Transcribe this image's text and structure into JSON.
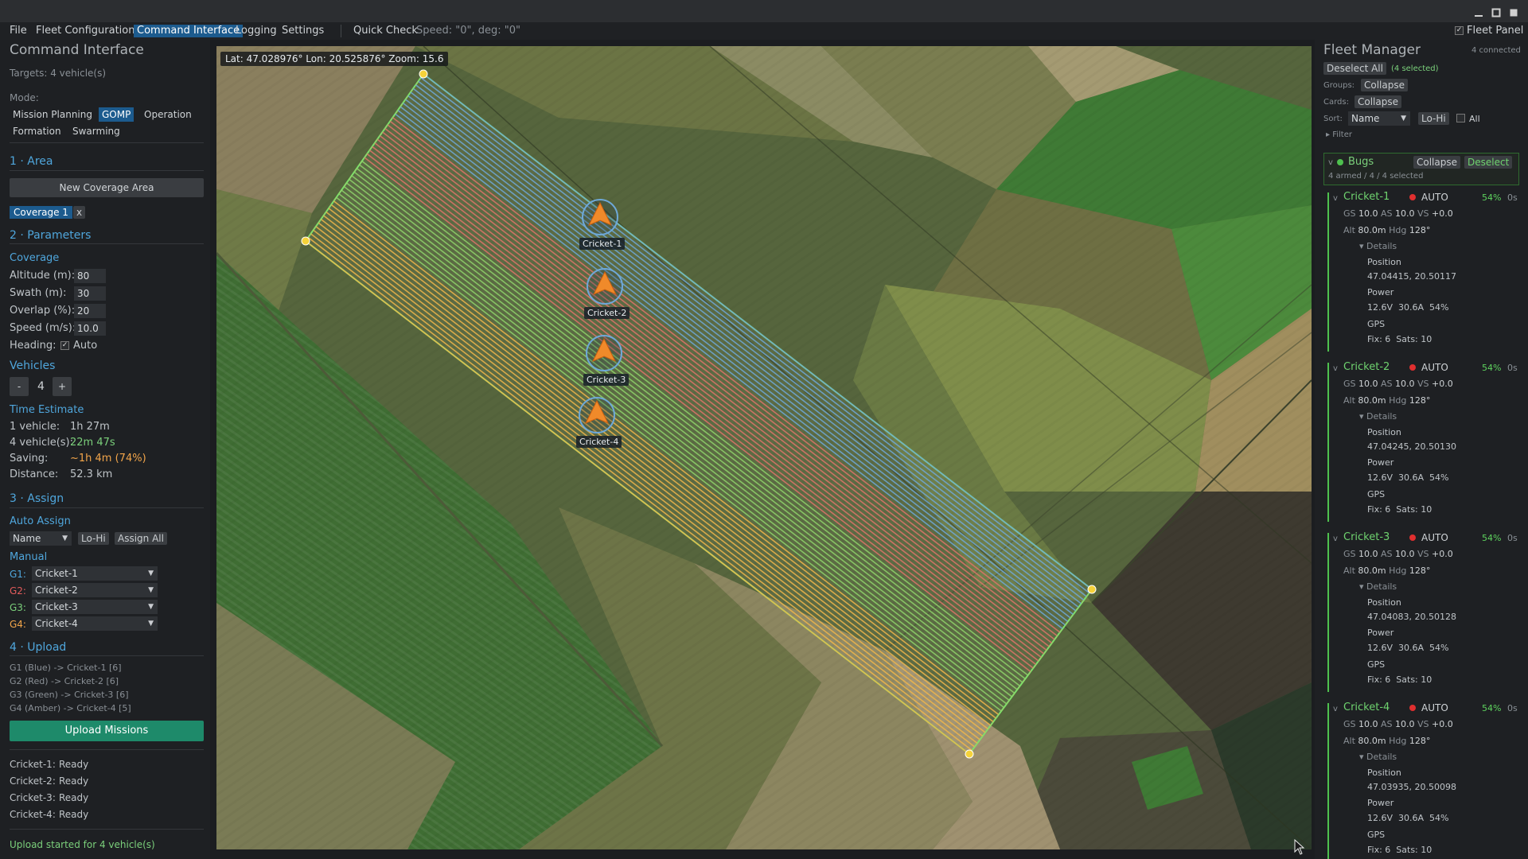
{
  "menu": {
    "items": [
      "File",
      "Fleet Configuration",
      "Command Interface",
      "Logging",
      "Settings"
    ],
    "quick_check": "Quick Check",
    "speed_readout": "Speed: \"0\", deg: \"0\"",
    "fleet_panel_label": "Fleet Panel"
  },
  "left": {
    "title": "Command Interface",
    "targets": "Targets: 4 vehicle(s)",
    "mode_label": "Mode:",
    "modes": [
      "Mission Planning",
      "GOMP",
      "Operation",
      "Formation",
      "Swarming"
    ],
    "area_header": "1 · Area",
    "new_area_button": "New Coverage Area",
    "coverage_chip": "Coverage 1",
    "coverage_close": "x",
    "params_header": "2 · Parameters",
    "coverage_sub": "Coverage",
    "altitude_label": "Altitude (m):",
    "altitude_value": "80",
    "swath_label": "Swath (m):",
    "swath_value": "30",
    "overlap_label": "Overlap (%):",
    "overlap_value": "20",
    "speed_label": "Speed (m/s):",
    "speed_value": "10.0",
    "heading_label": "Heading:",
    "heading_auto": "Auto",
    "vehicles_sub": "Vehicles",
    "minus": "-",
    "vehicle_count": "4",
    "plus": "+",
    "time_sub": "Time Estimate",
    "one_vehicle_label": "1 vehicle:",
    "one_vehicle_value": "1h 27m",
    "n_vehicle_label": "4 vehicle(s):",
    "n_vehicle_value": "22m 47s",
    "saving_label": "Saving:",
    "saving_value": "~1h 4m (74%)",
    "distance_label": "Distance:",
    "distance_value": "52.3 km",
    "assign_header": "3 · Assign",
    "auto_assign_sub": "Auto Assign",
    "sort_value": "Name",
    "lohi": "Lo-Hi",
    "assign_all": "Assign All",
    "manual_sub": "Manual",
    "groups": [
      {
        "label": "G1:",
        "value": "Cricket-1",
        "color": "#4fa6dc"
      },
      {
        "label": "G2:",
        "value": "Cricket-2",
        "color": "#e25b5b"
      },
      {
        "label": "G3:",
        "value": "Cricket-3",
        "color": "#7bd07b"
      },
      {
        "label": "G4:",
        "value": "Cricket-4",
        "color": "#f2a54a"
      }
    ],
    "upload_header": "4 · Upload",
    "upload_lines": [
      "G1 (Blue) -> Cricket-1 [6]",
      "G2 (Red) -> Cricket-2 [6]",
      "G3 (Green) -> Cricket-3 [6]",
      "G4 (Amber) -> Cricket-4 [5]"
    ],
    "upload_button": "Upload Missions",
    "status": [
      {
        "name": "Cricket-1:",
        "state": "Ready"
      },
      {
        "name": "Cricket-2:",
        "state": "Ready"
      },
      {
        "name": "Cricket-3:",
        "state": "Ready"
      },
      {
        "name": "Cricket-4:",
        "state": "Ready"
      }
    ],
    "footer": "Upload started for 4 vehicle(s)"
  },
  "map": {
    "coords": "Lat: 47.028976° Lon: 20.525876° Zoom: 15.6",
    "vehicles": [
      "Cricket-1",
      "Cricket-2",
      "Cricket-3",
      "Cricket-4"
    ],
    "group_colors": {
      "blue": "#6ea8d8",
      "red": "#e0736a",
      "green": "#8fd46a",
      "amber": "#f0b64a"
    }
  },
  "right": {
    "title": "Fleet Manager",
    "connected": "4 connected",
    "deselect_all": "Deselect All",
    "selected": "(4 selected)",
    "groups_label": "Groups:",
    "groups_btn": "Collapse",
    "cards_label": "Cards:",
    "cards_btn": "Collapse",
    "sort_label": "Sort:",
    "sort_value": "Name",
    "lohi": "Lo-Hi",
    "all": "All",
    "filter": "Filter",
    "group_name": "Bugs",
    "group_collapse": "Collapse",
    "group_deselect": "Deselect",
    "group_summary": "4 armed / 4 / 4 selected",
    "vehicles": [
      {
        "name": "Cricket-1",
        "mode": "AUTO",
        "pct": "54%",
        "age": "0s",
        "gs": "10.0",
        "as": "10.0",
        "vs": "+0.0",
        "alt": "80.0m",
        "hdg": "128°",
        "details": "Details",
        "position_label": "Position",
        "position": "47.04415, 20.50117",
        "power_label": "Power",
        "power": "12.6V  30.6A  54%",
        "gps_label": "GPS",
        "gps": "Fix: 6  Sats: 10"
      },
      {
        "name": "Cricket-2",
        "mode": "AUTO",
        "pct": "54%",
        "age": "0s",
        "gs": "10.0",
        "as": "10.0",
        "vs": "+0.0",
        "alt": "80.0m",
        "hdg": "128°",
        "details": "Details",
        "position_label": "Position",
        "position": "47.04245, 20.50130",
        "power_label": "Power",
        "power": "12.6V  30.6A  54%",
        "gps_label": "GPS",
        "gps": "Fix: 6  Sats: 10"
      },
      {
        "name": "Cricket-3",
        "mode": "AUTO",
        "pct": "54%",
        "age": "0s",
        "gs": "10.0",
        "as": "10.0",
        "vs": "+0.0",
        "alt": "80.0m",
        "hdg": "128°",
        "details": "Details",
        "position_label": "Position",
        "position": "47.04083, 20.50128",
        "power_label": "Power",
        "power": "12.6V  30.6A  54%",
        "gps_label": "GPS",
        "gps": "Fix: 6  Sats: 10"
      },
      {
        "name": "Cricket-4",
        "mode": "AUTO",
        "pct": "54%",
        "age": "0s",
        "gs": "10.0",
        "as": "10.0",
        "vs": "+0.0",
        "alt": "80.0m",
        "hdg": "128°",
        "details": "Details",
        "position_label": "Position",
        "position": "47.03935, 20.50098",
        "power_label": "Power",
        "power": "12.6V  30.6A  54%",
        "gps_label": "GPS",
        "gps": "Fix: 6  Sats: 10"
      }
    ]
  }
}
